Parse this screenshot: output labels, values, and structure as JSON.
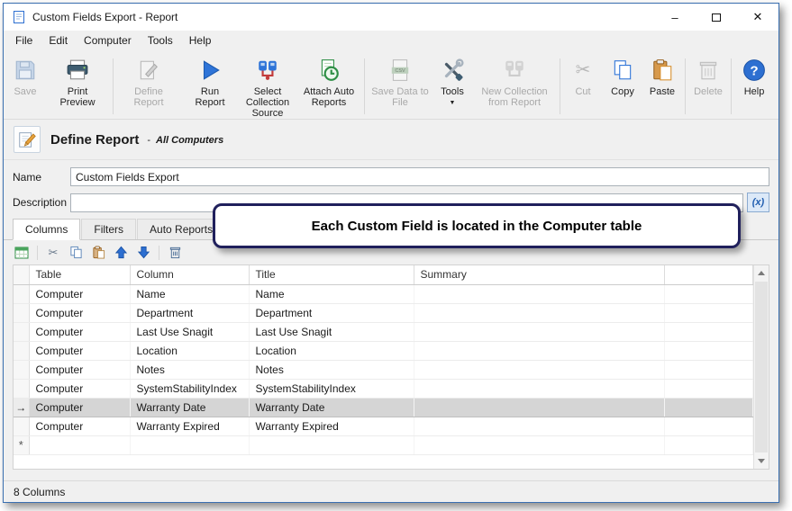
{
  "window": {
    "title": "Custom Fields Export - Report",
    "minimize_glyph": "–",
    "close_glyph": "✕"
  },
  "menu": {
    "items": [
      {
        "label": "File"
      },
      {
        "label": "Edit"
      },
      {
        "label": "Computer"
      },
      {
        "label": "Tools"
      },
      {
        "label": "Help"
      }
    ]
  },
  "toolbar": {
    "buttons": [
      {
        "label": "Save",
        "disabled": true
      },
      {
        "label": "Print Preview",
        "disabled": false
      },
      {
        "label": "Define Report",
        "disabled": true
      },
      {
        "label": "Run Report",
        "disabled": false
      },
      {
        "label": "Select Collection Source",
        "disabled": false
      },
      {
        "label": "Attach Auto Reports",
        "disabled": false
      },
      {
        "label": "Save Data to File",
        "disabled": true
      },
      {
        "label": "Tools",
        "disabled": false,
        "has_dropdown": true
      },
      {
        "label": "New Collection from Report",
        "disabled": true
      },
      {
        "label": "Cut",
        "disabled": true
      },
      {
        "label": "Copy",
        "disabled": false
      },
      {
        "label": "Paste",
        "disabled": false
      },
      {
        "label": "Delete",
        "disabled": true
      },
      {
        "label": "Help",
        "disabled": false
      }
    ],
    "dropdown_glyph": "▼"
  },
  "section": {
    "title": "Define Report",
    "separator": "-",
    "subtitle": "All Computers"
  },
  "form": {
    "name_label": "Name",
    "name_value": "Custom Fields Export",
    "description_label": "Description",
    "description_value": "",
    "expression_button": "(x)"
  },
  "tabs": [
    {
      "label": "Columns",
      "active": true
    },
    {
      "label": "Filters",
      "active": false
    },
    {
      "label": "Auto Reports",
      "active": false
    }
  ],
  "callout": {
    "text": "Each Custom Field is located in the Computer table"
  },
  "grid": {
    "headers": [
      "Table",
      "Column",
      "Title",
      "Summary"
    ],
    "rows": [
      {
        "table": "Computer",
        "column": "Name",
        "title": "Name",
        "summary": ""
      },
      {
        "table": "Computer",
        "column": "Department",
        "title": "Department",
        "summary": ""
      },
      {
        "table": "Computer",
        "column": "Last Use Snagit",
        "title": "Last Use Snagit",
        "summary": ""
      },
      {
        "table": "Computer",
        "column": "Location",
        "title": "Location",
        "summary": ""
      },
      {
        "table": "Computer",
        "column": "Notes",
        "title": "Notes",
        "summary": ""
      },
      {
        "table": "Computer",
        "column": "SystemStabilityIndex",
        "title": "SystemStabilityIndex",
        "summary": ""
      },
      {
        "table": "Computer",
        "column": "Warranty Date",
        "title": "Warranty Date",
        "summary": ""
      },
      {
        "table": "Computer",
        "column": "Warranty Expired",
        "title": "Warranty Expired",
        "summary": ""
      }
    ],
    "selected_row_index": 6,
    "current_row_marker": "→",
    "new_row_marker": "*"
  },
  "icons": {
    "cut_glyph": "✂"
  },
  "status": {
    "text": "8 Columns"
  }
}
